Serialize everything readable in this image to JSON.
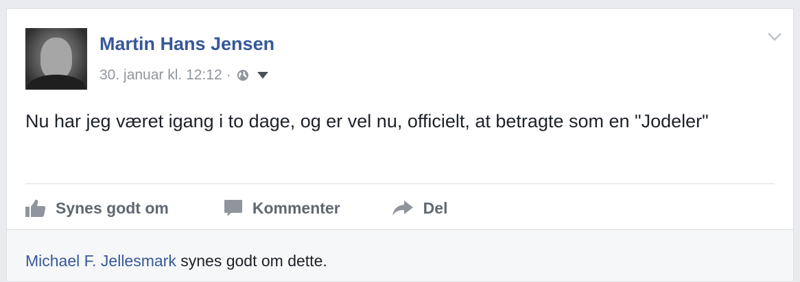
{
  "post": {
    "author": "Martin Hans Jensen",
    "timestamp": "30. januar kl. 12:12",
    "separator": "·",
    "privacy_icon": "globe-icon",
    "text": "Nu har jeg været igang i to dage, og er vel nu, officielt, at betragte som en \"Jodeler\""
  },
  "actions": {
    "like": "Synes godt om",
    "comment": "Kommenter",
    "share": "Del"
  },
  "likes": {
    "liker": "Michael F. Jellesmark",
    "suffix": " synes godt om dette."
  },
  "colors": {
    "link": "#365899",
    "muted": "#90949c",
    "action": "#606770",
    "background": "#e9ebee"
  }
}
